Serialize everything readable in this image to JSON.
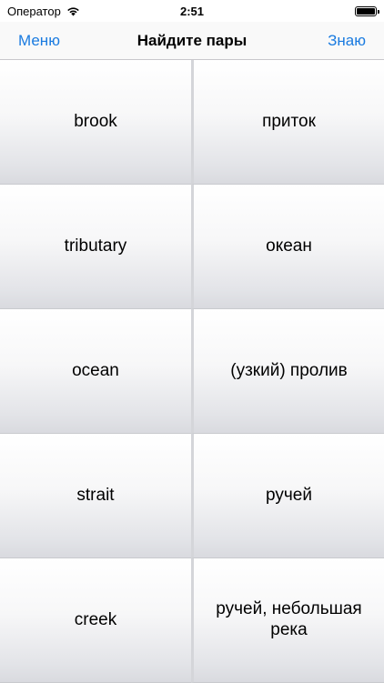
{
  "status_bar": {
    "carrier": "Оператор",
    "time": "2:51"
  },
  "nav": {
    "left_button": "Меню",
    "title": "Найдите пары",
    "right_button": "Знаю",
    "accent_color": "#1a7be0"
  },
  "pairs": {
    "left": [
      "brook",
      "tributary",
      "ocean",
      "strait",
      "creek"
    ],
    "right": [
      "приток",
      "океан",
      "(узкий) пролив",
      "ручей",
      "ручей, небольшая река"
    ]
  }
}
